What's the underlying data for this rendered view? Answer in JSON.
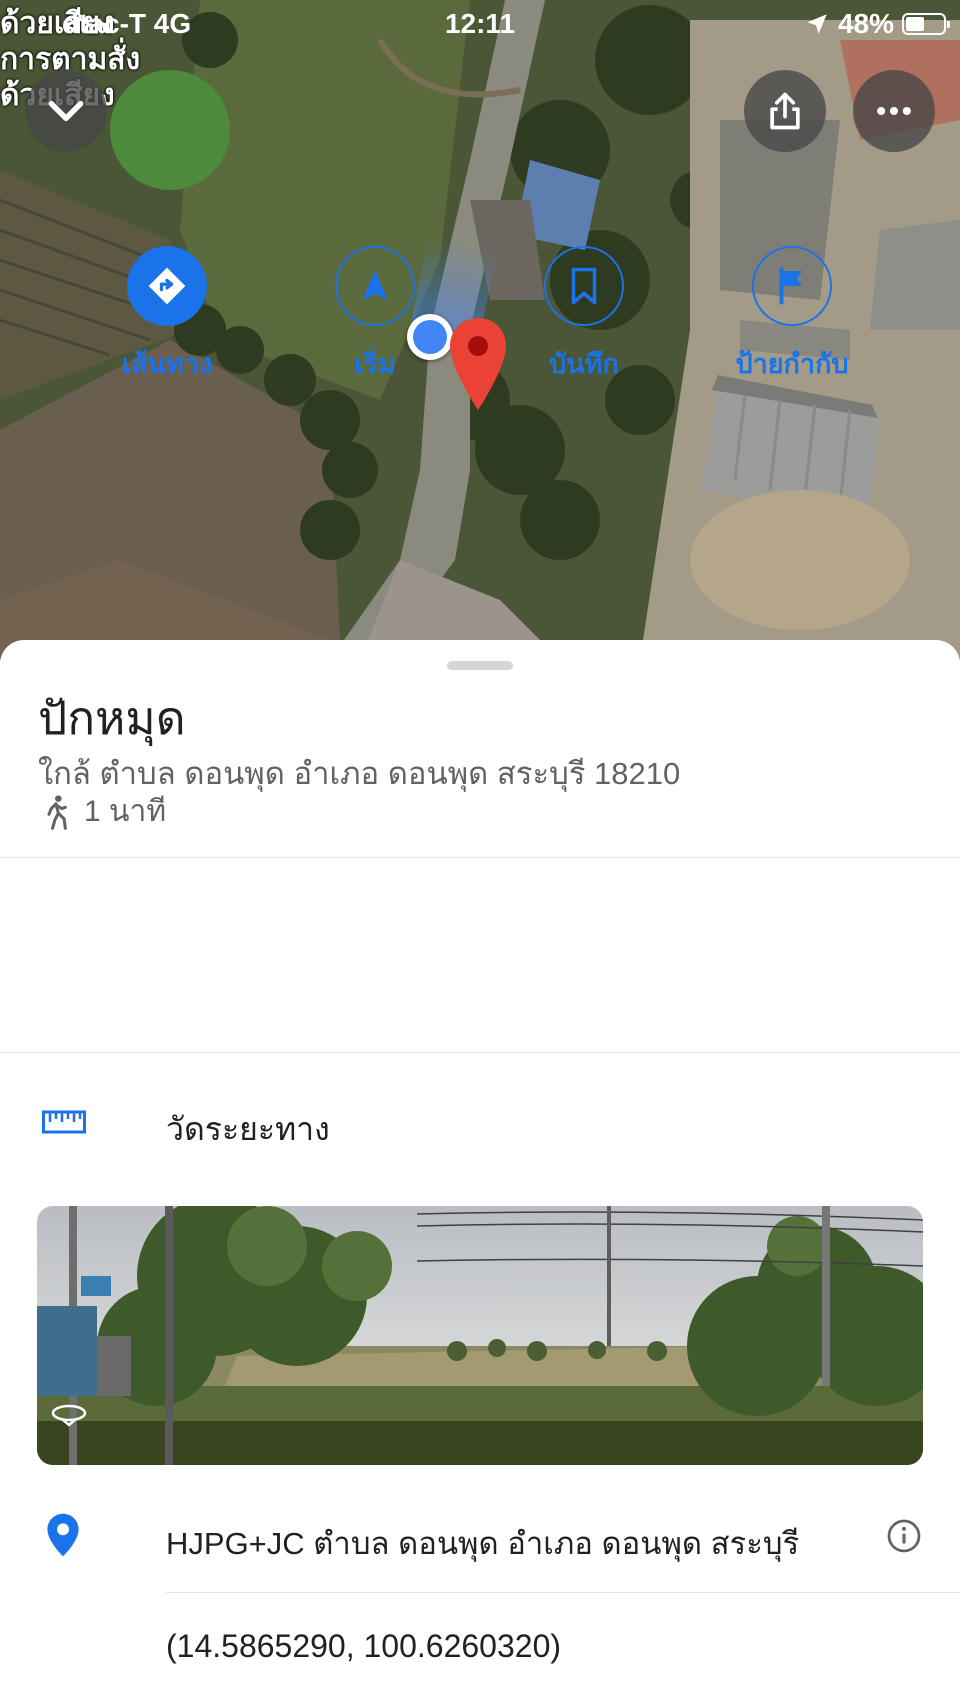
{
  "status_bar": {
    "carrier": "dtac-T  4G",
    "time": "12:11",
    "battery": "48%",
    "overlay_text": "ด้วยเสียง\nการตามสั่ง\nด้วยเสียง"
  },
  "map": {
    "pin_color": "#ea4335",
    "my_location_color": "#4285f4"
  },
  "place": {
    "title": "ปักหมุด",
    "address": "ใกล้ ตำบล ดอนพุด อำเภอ ดอนพุด สระบุรี 18210",
    "walk_time": "1 นาที"
  },
  "actions": [
    {
      "label": "เส้นทาง",
      "icon": "directions-icon"
    },
    {
      "label": "เริ่ม",
      "icon": "navigation-arrow-icon"
    },
    {
      "label": "บันทึก",
      "icon": "bookmark-icon"
    },
    {
      "label": "ป้ายกำกับ",
      "icon": "flag-icon"
    }
  ],
  "measure": {
    "label": "วัดระยะทาง",
    "icon": "ruler-icon"
  },
  "plus_code_address": "HJPG+JC ตำบล ดอนพุด อำเภอ ดอนพุด สระบุรี",
  "coordinates": "(14.5865290, 100.6260320)",
  "accent_color": "#1a73e8"
}
